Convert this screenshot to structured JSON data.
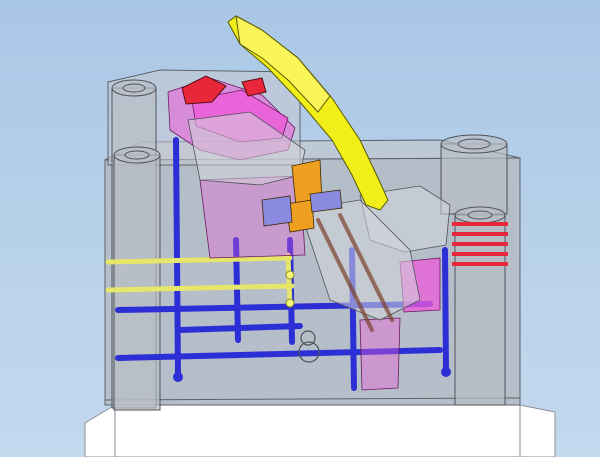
{
  "scene": {
    "kind": "3D CAD viewport - translucent mold assembly",
    "colors": {
      "background_top": "#a9c7e6",
      "background_bottom": "#c4d8ee",
      "mold_body": "#b3b8bf",
      "cooling_channels_blue": "#2c2fd6",
      "cooling_channels_yellow": "#e6e66a",
      "slider_yellow": "#f2ee1a",
      "insert_magenta": "#ee5ad8",
      "insert_red": "#e8283a",
      "lifter_orange": "#f0a020",
      "lifter_purple": "#8a8ae0"
    }
  }
}
